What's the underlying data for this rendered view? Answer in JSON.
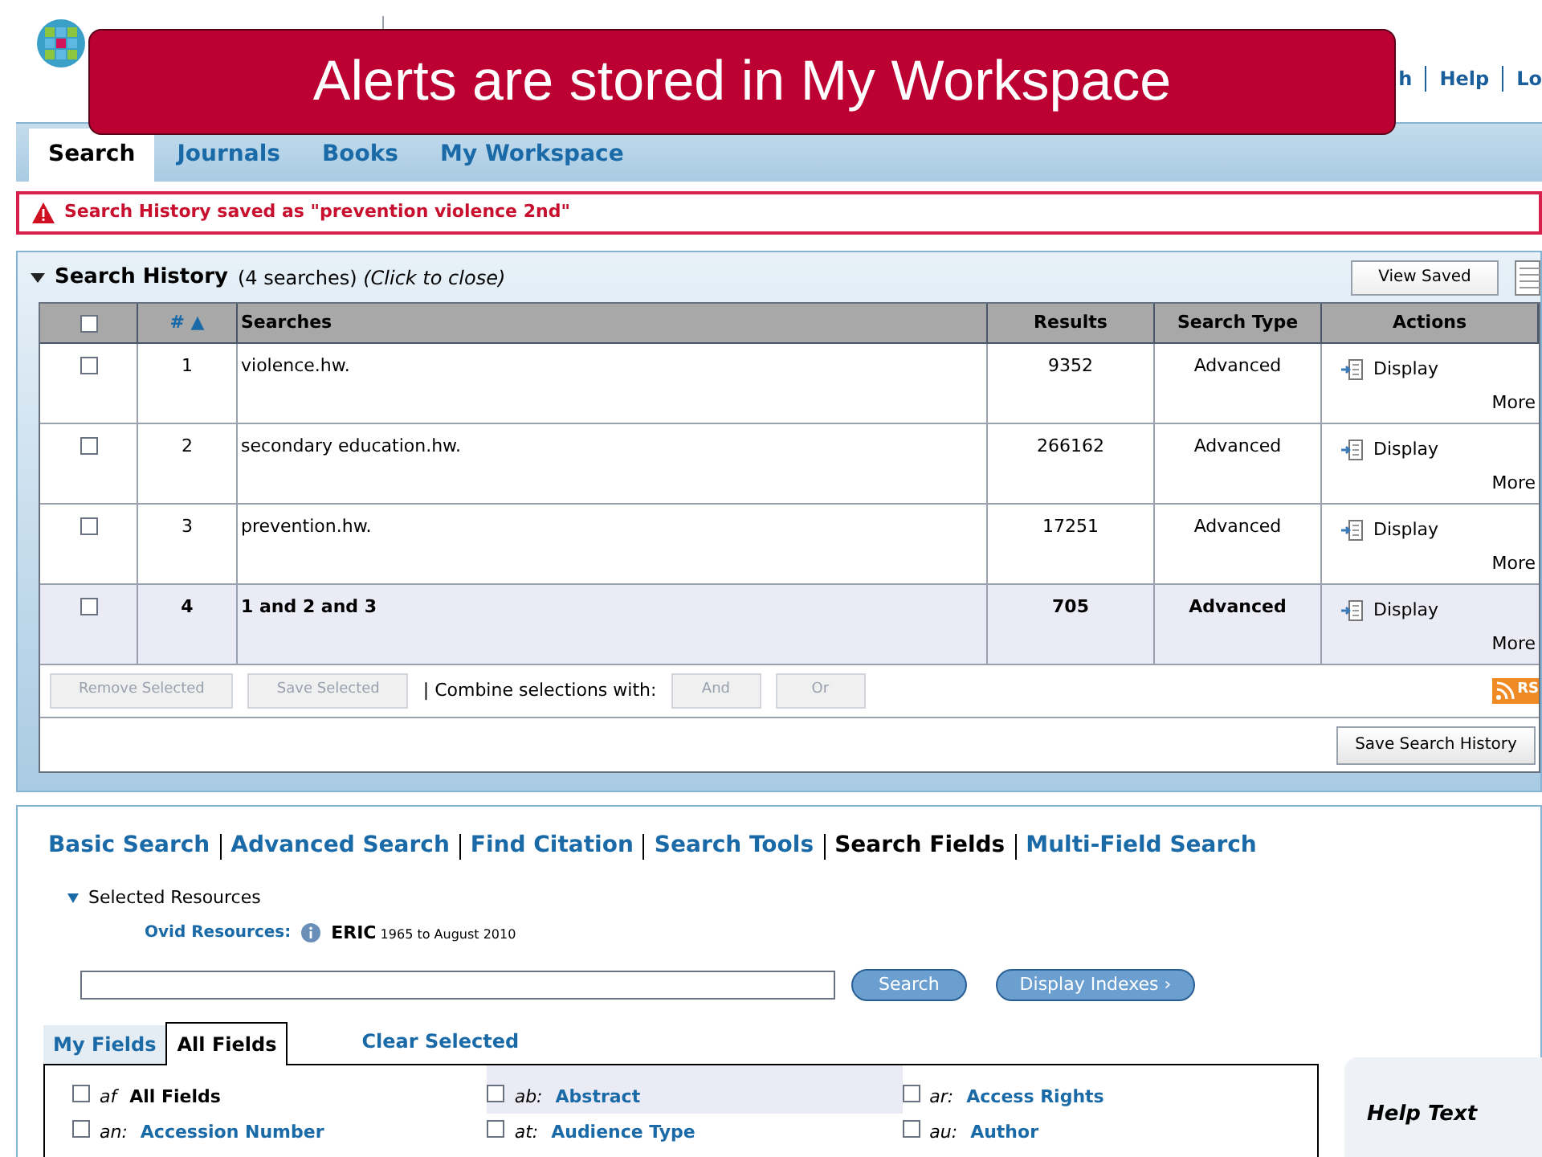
{
  "header": {
    "links": [
      "h",
      "Help",
      "Lo"
    ]
  },
  "banner": {
    "text": "Alerts are stored in My Workspace"
  },
  "tabs": [
    {
      "label": "Search",
      "selected": true
    },
    {
      "label": "Journals",
      "selected": false
    },
    {
      "label": "Books",
      "selected": false
    },
    {
      "label": "My Workspace",
      "selected": false
    }
  ],
  "alert": {
    "text": "Search History saved as \"prevention violence 2nd\""
  },
  "search_history": {
    "title": "Search History",
    "count": "(4 searches)",
    "hint": "(Click to close)",
    "view_saved": "View Saved",
    "columns": [
      "# ▲",
      "Searches",
      "Results",
      "Search Type",
      "Actions"
    ],
    "select_all_checked": false,
    "rows": [
      {
        "number": "1",
        "query": "violence.hw.",
        "results": "9352",
        "type": "Advanced",
        "display": "Display",
        "more": "More",
        "checked": false,
        "current": false
      },
      {
        "number": "2",
        "query": "secondary education.hw.",
        "results": "266162",
        "type": "Advanced",
        "display": "Display",
        "more": "More",
        "checked": false,
        "current": false
      },
      {
        "number": "3",
        "query": "prevention.hw.",
        "results": "17251",
        "type": "Advanced",
        "display": "Display",
        "more": "More",
        "checked": false,
        "current": false
      },
      {
        "number": "4",
        "query": "1 and 2 and 3",
        "results": "705",
        "type": "Advanced",
        "display": "Display",
        "more": "More",
        "checked": false,
        "current": true
      }
    ],
    "buttons": [
      "Remove Selected",
      "Save Selected"
    ],
    "combine_label": "| Combine selections with:",
    "combine_buttons": [
      "And",
      "Or"
    ],
    "rss": "RS",
    "save_history": "Save Search History"
  },
  "search_nav": [
    {
      "label": "Basic Search",
      "selected": false
    },
    {
      "label": "Advanced Search",
      "selected": false
    },
    {
      "label": "Find Citation",
      "selected": false
    },
    {
      "label": "Search Tools",
      "selected": false
    },
    {
      "label": "Search Fields",
      "selected": true
    },
    {
      "label": "Multi-Field Search",
      "selected": false
    }
  ],
  "resources": {
    "label": "Selected Resources",
    "ovid_label": "Ovid Resources:",
    "database": "ERIC",
    "range": "1965 to August 2010"
  },
  "search_button": "Search",
  "indexes_button": "Display Indexes ›",
  "field_tabs": [
    {
      "label": "My Fields",
      "selected": false
    },
    {
      "label": "All Fields",
      "selected": true
    }
  ],
  "clear_selected": "Clear Selected",
  "fields": [
    {
      "code": "af",
      "name": "All Fields",
      "checked": false,
      "highlighted": false,
      "link": false
    },
    {
      "code": "ab:",
      "name": "Abstract",
      "checked": false,
      "highlighted": true,
      "link": true
    },
    {
      "code": "ar:",
      "name": "Access Rights",
      "checked": false,
      "highlighted": false,
      "link": true
    },
    {
      "code": "an:",
      "name": "Accession Number",
      "checked": false,
      "highlighted": false,
      "link": true
    },
    {
      "code": "at:",
      "name": "Audience Type",
      "checked": false,
      "highlighted": false,
      "link": true
    },
    {
      "code": "au:",
      "name": "Author",
      "checked": false,
      "highlighted": false,
      "link": true
    }
  ],
  "help_text": "Help Text"
}
